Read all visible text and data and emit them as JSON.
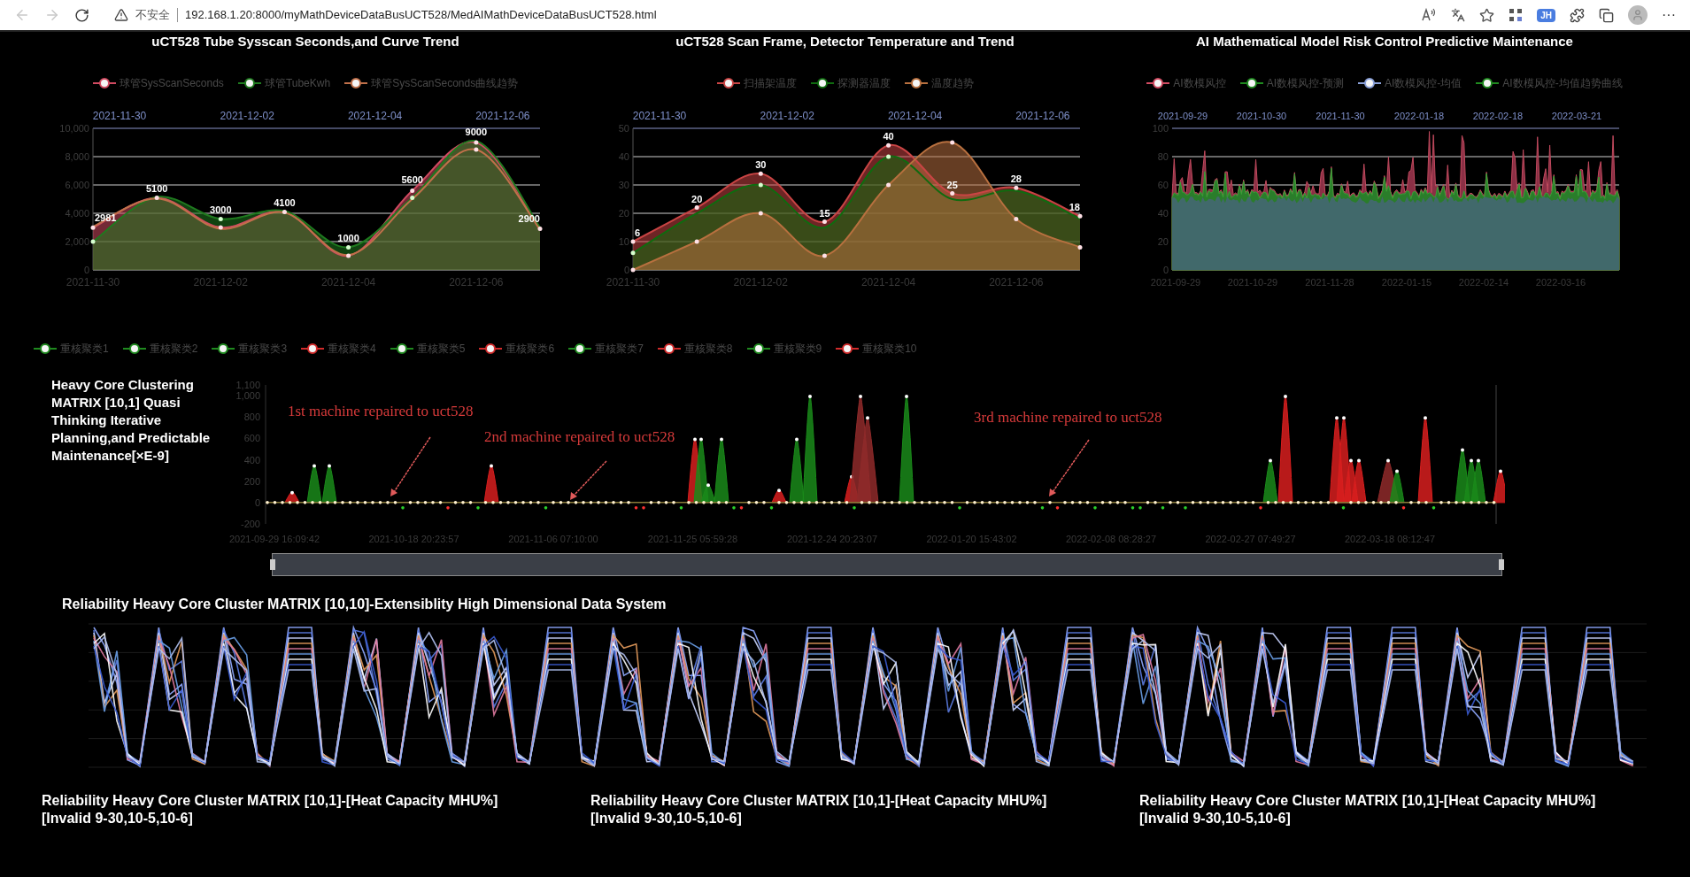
{
  "browser": {
    "security_label": "不安全",
    "url": "192.168.1.20:8000/myMathDeviceDataBusUCT528/MedAIMathDeviceDataBusUCT528.html",
    "profile_badge": "JH",
    "more": "···"
  },
  "top_charts": [
    {
      "title": "uCT528 Tube Sysscan Seconds,and Curve Trend",
      "top_axis_labels": [
        "2021-11-30",
        "2021-12-02",
        "2021-12-04",
        "2021-12-06"
      ],
      "chart_data": {
        "type": "area",
        "categories": [
          "2021-11-30",
          null,
          "2021-12-02",
          null,
          "2021-12-04",
          null,
          "2021-12-06",
          null
        ],
        "ylim": [
          0,
          10000
        ],
        "grid": true,
        "yticks": [
          {
            "value": 0,
            "label": "0"
          },
          {
            "value": 2000,
            "label": "2,000"
          },
          {
            "value": 4000,
            "label": "4,000"
          },
          {
            "value": 6000,
            "label": "6,000"
          },
          {
            "value": 8000,
            "label": "8,000"
          },
          {
            "value": 10000,
            "label": "10,000"
          }
        ],
        "series": [
          {
            "name": "球管SysScanSeconds",
            "color": "#d14a61",
            "type": "area",
            "values": [
              2981,
              5100,
              3000,
              4100,
              1000,
              5600,
              9000,
              2900
            ],
            "value_labels": [
              "2981",
              "5100",
              "3000",
              "4100",
              "1000",
              "5600",
              "9000",
              "2900"
            ]
          },
          {
            "name": "球管TubeKwh",
            "color": "#1f7a1f",
            "type": "area",
            "values": [
              2000,
              5150,
              3600,
              4150,
              1600,
              5100,
              9100,
              3000
            ]
          },
          {
            "name": "球管SysScanSeconds曲线趋势",
            "color": "#c0704a",
            "type": "line",
            "values": [
              3050,
              5050,
              2900,
              4050,
              1050,
              5000,
              8500,
              2850
            ]
          }
        ]
      }
    },
    {
      "title": "uCT528 Scan Frame, Detector Temperature and Trend",
      "top_axis_labels": [
        "2021-11-30",
        "2021-12-02",
        "2021-12-04",
        "2021-12-06"
      ],
      "chart_data": {
        "type": "area",
        "categories": [
          "2021-11-30",
          null,
          "2021-12-02",
          null,
          "2021-12-04",
          null,
          "2021-12-06",
          null
        ],
        "ylim": [
          0,
          50
        ],
        "grid": true,
        "yticks": [
          {
            "value": 0,
            "label": "0"
          },
          {
            "value": 10,
            "label": "10"
          },
          {
            "value": 20,
            "label": "20"
          },
          {
            "value": 30,
            "label": "30"
          },
          {
            "value": 40,
            "label": "40"
          },
          {
            "value": 50,
            "label": "50"
          }
        ],
        "series": [
          {
            "name": "扫描架温度",
            "color": "#c94444",
            "type": "area",
            "values": [
              10,
              22,
              34,
              17,
              44,
              27,
              29,
              19
            ]
          },
          {
            "name": "探测器温度",
            "color": "#0f6b0f",
            "type": "area",
            "values": [
              6,
              20,
              30,
              15,
              40,
              25,
              28,
              18
            ],
            "value_labels": [
              "6",
              "20",
              "30",
              "15",
              "40",
              "25",
              "28",
              "18"
            ]
          },
          {
            "name": "温度趋势",
            "color": "#b8703f",
            "type": "area",
            "values": [
              0,
              10,
              20,
              5,
              30,
              45,
              18,
              8
            ]
          }
        ]
      }
    },
    {
      "title": "AI Mathematical Model Risk Control Predictive Maintenance",
      "legend": [
        {
          "label": "AI数模风控",
          "color": "#d14a61"
        },
        {
          "label": "AI数模风控-预测",
          "color": "#1f8a1f"
        },
        {
          "label": "AI数模风控-均值",
          "color": "#8aa0d8"
        },
        {
          "label": "AI数模风控-均值趋势曲线",
          "color": "#1f8a1f"
        }
      ],
      "axes": {
        "top_labels": [
          "2021-09-29",
          "2021-10-30",
          "2021-11-30",
          "2022-01-18",
          "2022-02-18",
          "2022-03-21"
        ],
        "bottom_labels": [
          "2021-09-29",
          "2021-10-29",
          "2021-11-28",
          "2022-01-15",
          "2022-02-14",
          "2022-03-16"
        ],
        "y_labels": [
          "100",
          "80",
          "60",
          "40",
          "20",
          "0"
        ]
      }
    }
  ],
  "cluster_chart": {
    "title": "Heavy Core Clustering MATRIX [10,1] Quasi Thinking Iterative Planning,and Predictable Maintenance[×E-9]",
    "legend": [
      {
        "label": "重核聚类1",
        "color": "#1f8a1f"
      },
      {
        "label": "重核聚类2",
        "color": "#1f8a1f"
      },
      {
        "label": "重核聚类3",
        "color": "#1f8a1f"
      },
      {
        "label": "重核聚类4",
        "color": "#d12b2b"
      },
      {
        "label": "重核聚类5",
        "color": "#1f8a1f"
      },
      {
        "label": "重核聚类6",
        "color": "#d12b2b"
      },
      {
        "label": "重核聚类7",
        "color": "#1f8a1f"
      },
      {
        "label": "重核聚类8",
        "color": "#d12b2b"
      },
      {
        "label": "重核聚类9",
        "color": "#1f8a1f"
      },
      {
        "label": "重核聚类10",
        "color": "#d12b2b"
      }
    ],
    "y_labels": [
      "1,100",
      "1,000",
      "800",
      "600",
      "400",
      "200",
      "0",
      "-200"
    ],
    "x_labels": [
      "2021-09-29 16:09:42",
      "2021-10-18 20:23:57",
      "2021-11-06 07:10:00",
      "2021-11-25 05:59:28",
      "2021-12-24 20:23:07",
      "2022-01-20 15:43:02",
      "2022-02-08 08:28:27",
      "2022-02-27 07:49:27",
      "2022-03-18 08:12:47"
    ],
    "annotations": [
      "1st machine repaired to uct528",
      "2nd machine repaired to uct528",
      "3rd machine repaired to uct528"
    ],
    "zoom_slider": {
      "level": 1
    }
  },
  "matrix_chart": {
    "title": "Reliability Heavy Core Cluster MATRIX [10,10]-Extensiblity High Dimensional Data System"
  },
  "panels": [
    {
      "title": "Reliability Heavy Core Cluster MATRIX [10,1]-[Heat Capacity MHU%] [Invalid 9-30,10-5,10-6]"
    },
    {
      "title": "Reliability Heavy Core Cluster MATRIX [10,1]-[Heat Capacity MHU%] [Invalid 9-30,10-5,10-6]"
    },
    {
      "title": "Reliability Heavy Core Cluster MATRIX [10,1]-[Heat Capacity MHU%] [Invalid 9-30,10-5,10-6]"
    }
  ]
}
